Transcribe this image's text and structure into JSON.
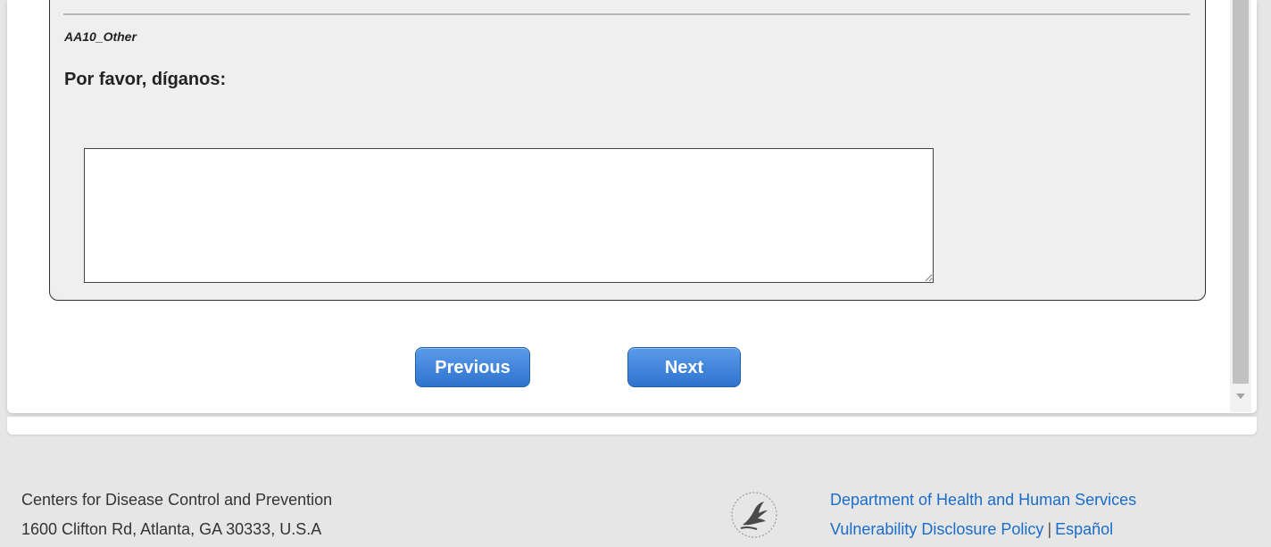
{
  "question": {
    "code": "AA10_Other",
    "prompt": "Por favor, díganos:",
    "answer_value": ""
  },
  "navigation": {
    "previous_label": "Previous",
    "next_label": "Next"
  },
  "footer": {
    "org_name": "Centers for Disease Control and Prevention",
    "address": "1600 Clifton Rd, Atlanta, GA 30333, U.S.A",
    "logo_icon": "hhs-eagle-logo-icon",
    "links": {
      "hhs": "Department of Health and Human Services",
      "vdp": "Vulnerability Disclosure Policy",
      "separator": "|",
      "espanol": "Español"
    }
  },
  "colors": {
    "button_blue": "#2f73cf",
    "link_blue": "#1a6dc9",
    "panel_bg": "#efefef",
    "page_bg": "#e6e6e6"
  }
}
